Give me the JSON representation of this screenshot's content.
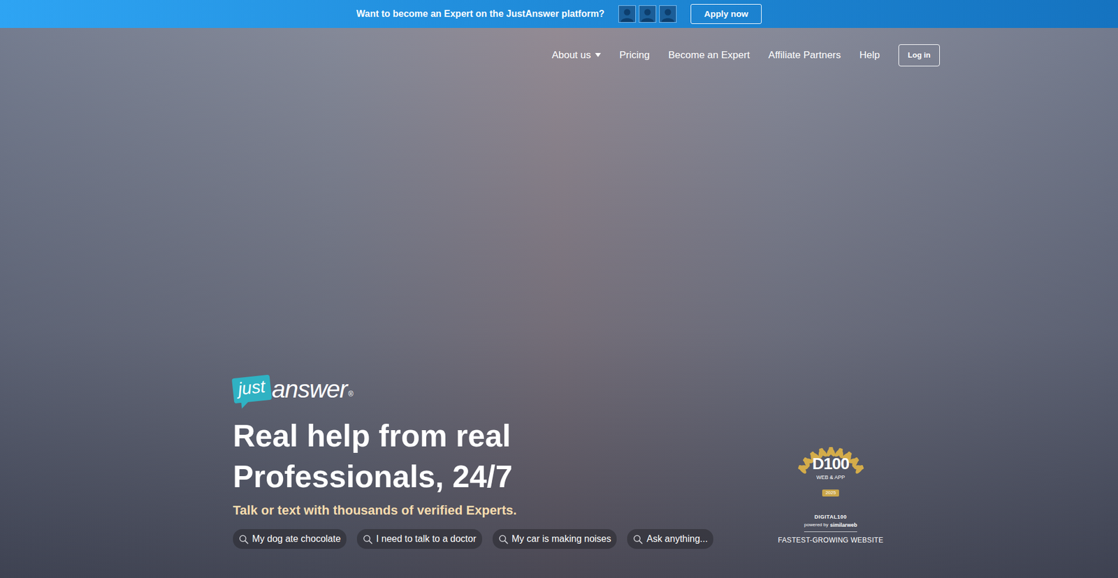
{
  "banner": {
    "text": "Want to become an Expert on the JustAnswer platform?",
    "button": "Apply now"
  },
  "nav": {
    "items": [
      {
        "label": "About us",
        "expanded": false
      },
      {
        "label": "Pricing"
      },
      {
        "label": "Become an Expert"
      },
      {
        "label": "Affiliate Partners"
      },
      {
        "label": "Help"
      }
    ],
    "login": "Log in"
  },
  "logo": {
    "badge": "just",
    "word": "answer",
    "mark": "®"
  },
  "hero": {
    "title": "Real help from real Professionals, 24/7",
    "subtitle": "Talk or text with thousands of verified Experts.",
    "suggestions": [
      "My dog ate chocolate",
      "I need to talk to a doctor",
      "My car is making noises",
      "Ask anything..."
    ]
  },
  "award": {
    "logo": "D100",
    "category": "WEB & APP",
    "year": "2025",
    "name": "DIGITAL100",
    "powered": "powered by",
    "partner": "similarweb",
    "caption": "FASTEST-GROWING WEBSITE"
  }
}
